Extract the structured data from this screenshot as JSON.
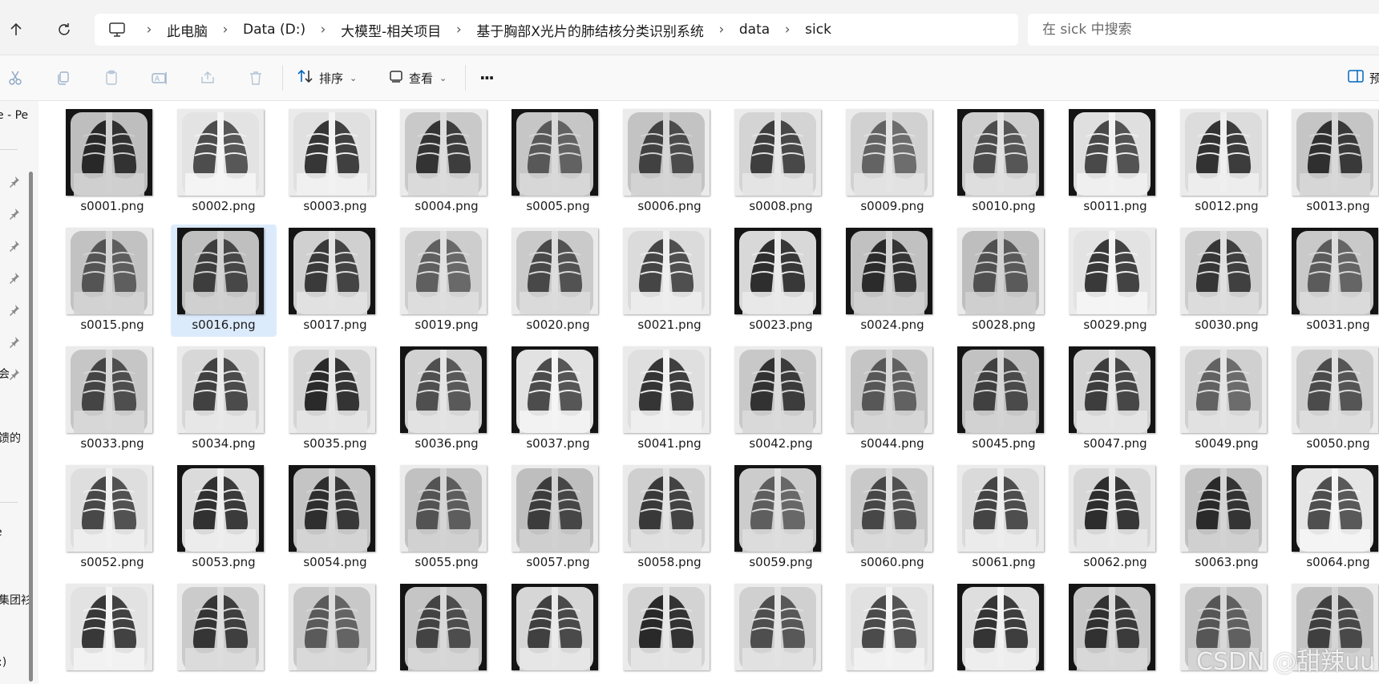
{
  "address_bar": {
    "breadcrumbs": [
      "此电脑",
      "Data (D:)",
      "大模型-相关项目",
      "基于胸部X光片的肺结核分类识别系统",
      "data",
      "sick"
    ],
    "search_placeholder": "在 sick 中搜索"
  },
  "toolbar": {
    "sort_label": "排序",
    "view_label": "查看",
    "more_label": "···",
    "preview_label": "预"
  },
  "sidebar": {
    "items": [
      {
        "label": "e - Pe"
      },
      {
        "label": "会"
      },
      {
        "label": "馈的"
      },
      {
        "label": "e"
      },
      {
        "label": "集团衫"
      },
      {
        "label": ":)"
      }
    ]
  },
  "files": [
    "s0001.png",
    "s0002.png",
    "s0003.png",
    "s0004.png",
    "s0005.png",
    "s0006.png",
    "s0008.png",
    "s0009.png",
    "s0010.png",
    "s0011.png",
    "s0012.png",
    "s0013.png",
    "s0015.png",
    "s0016.png",
    "s0017.png",
    "s0019.png",
    "s0020.png",
    "s0021.png",
    "s0023.png",
    "s0024.png",
    "s0028.png",
    "s0029.png",
    "s0030.png",
    "s0031.png",
    "s0033.png",
    "s0034.png",
    "s0035.png",
    "s0036.png",
    "s0037.png",
    "s0041.png",
    "s0042.png",
    "s0044.png",
    "s0045.png",
    "s0047.png",
    "s0049.png",
    "s0050.png",
    "s0052.png",
    "s0053.png",
    "s0054.png",
    "s0055.png",
    "s0057.png",
    "s0058.png",
    "s0059.png",
    "s0060.png",
    "s0061.png",
    "s0062.png",
    "s0063.png",
    "s0064.png",
    "",
    "",
    "",
    "",
    "",
    "",
    "",
    "",
    "",
    "",
    "",
    ""
  ],
  "selected_file": "s0016.png",
  "watermark": "CSDN @甜辣uu",
  "colors": {
    "selection": "#dcebfc",
    "accent": "#0067c0"
  }
}
